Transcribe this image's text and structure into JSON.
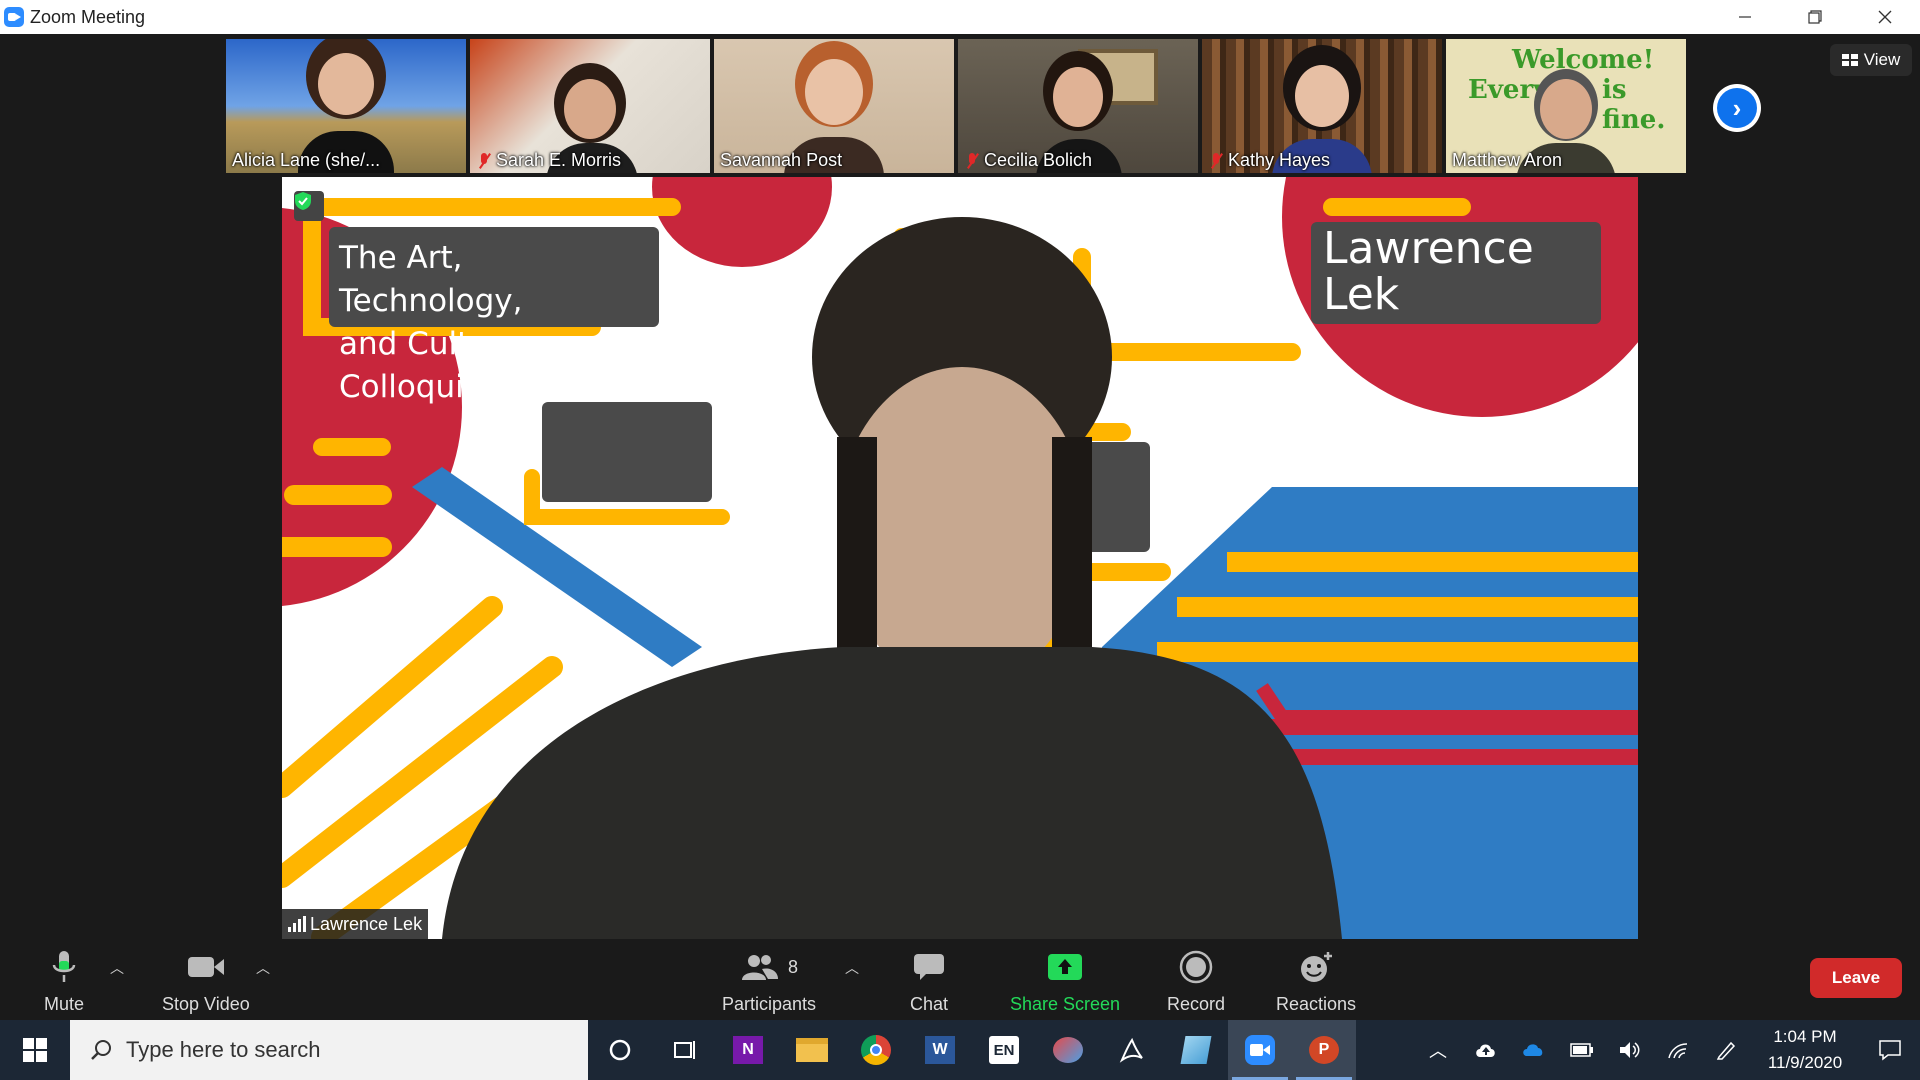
{
  "window": {
    "title": "Zoom Meeting"
  },
  "participants_strip": [
    {
      "name": "Alicia Lane (she/...",
      "muted": false
    },
    {
      "name": "Sarah E. Morris",
      "muted": true
    },
    {
      "name": "Savannah Post",
      "muted": false
    },
    {
      "name": "Cecilia Bolich",
      "muted": true
    },
    {
      "name": "Kathy Hayes",
      "muted": true
    },
    {
      "name": "Matthew Aron",
      "muted": false
    }
  ],
  "thumb_background_text": {
    "line1": "Welcome!",
    "line2": "Everyt",
    "line3": "is fine."
  },
  "view_button": {
    "label": "View"
  },
  "main_video": {
    "speaker_name": "Lawrence Lek",
    "slide_title": "The Art, Technology, and Culture Colloquium",
    "slide_title_line1": "The Art, Technology,",
    "slide_title_line2": "and Culture Colloquium",
    "slide_speaker_line1": "Lawrence",
    "slide_speaker_line2": "Lek"
  },
  "toolbar": {
    "mute_label": "Mute",
    "stop_video_label": "Stop Video",
    "participants_label": "Participants",
    "participants_count": "8",
    "chat_label": "Chat",
    "share_screen_label": "Share Screen",
    "record_label": "Record",
    "reactions_label": "Reactions",
    "leave_label": "Leave"
  },
  "taskbar": {
    "search_placeholder": "Type here to search",
    "time": "1:04 PM",
    "date": "11/9/2020",
    "language": "EN"
  },
  "colors": {
    "zoom_blue": "#2d8cff",
    "share_green": "#23d959",
    "leave_red": "#d12a2a",
    "slide_red": "#c8263c",
    "slide_yellow": "#ffb500",
    "slide_blue": "#2f7cc4"
  }
}
